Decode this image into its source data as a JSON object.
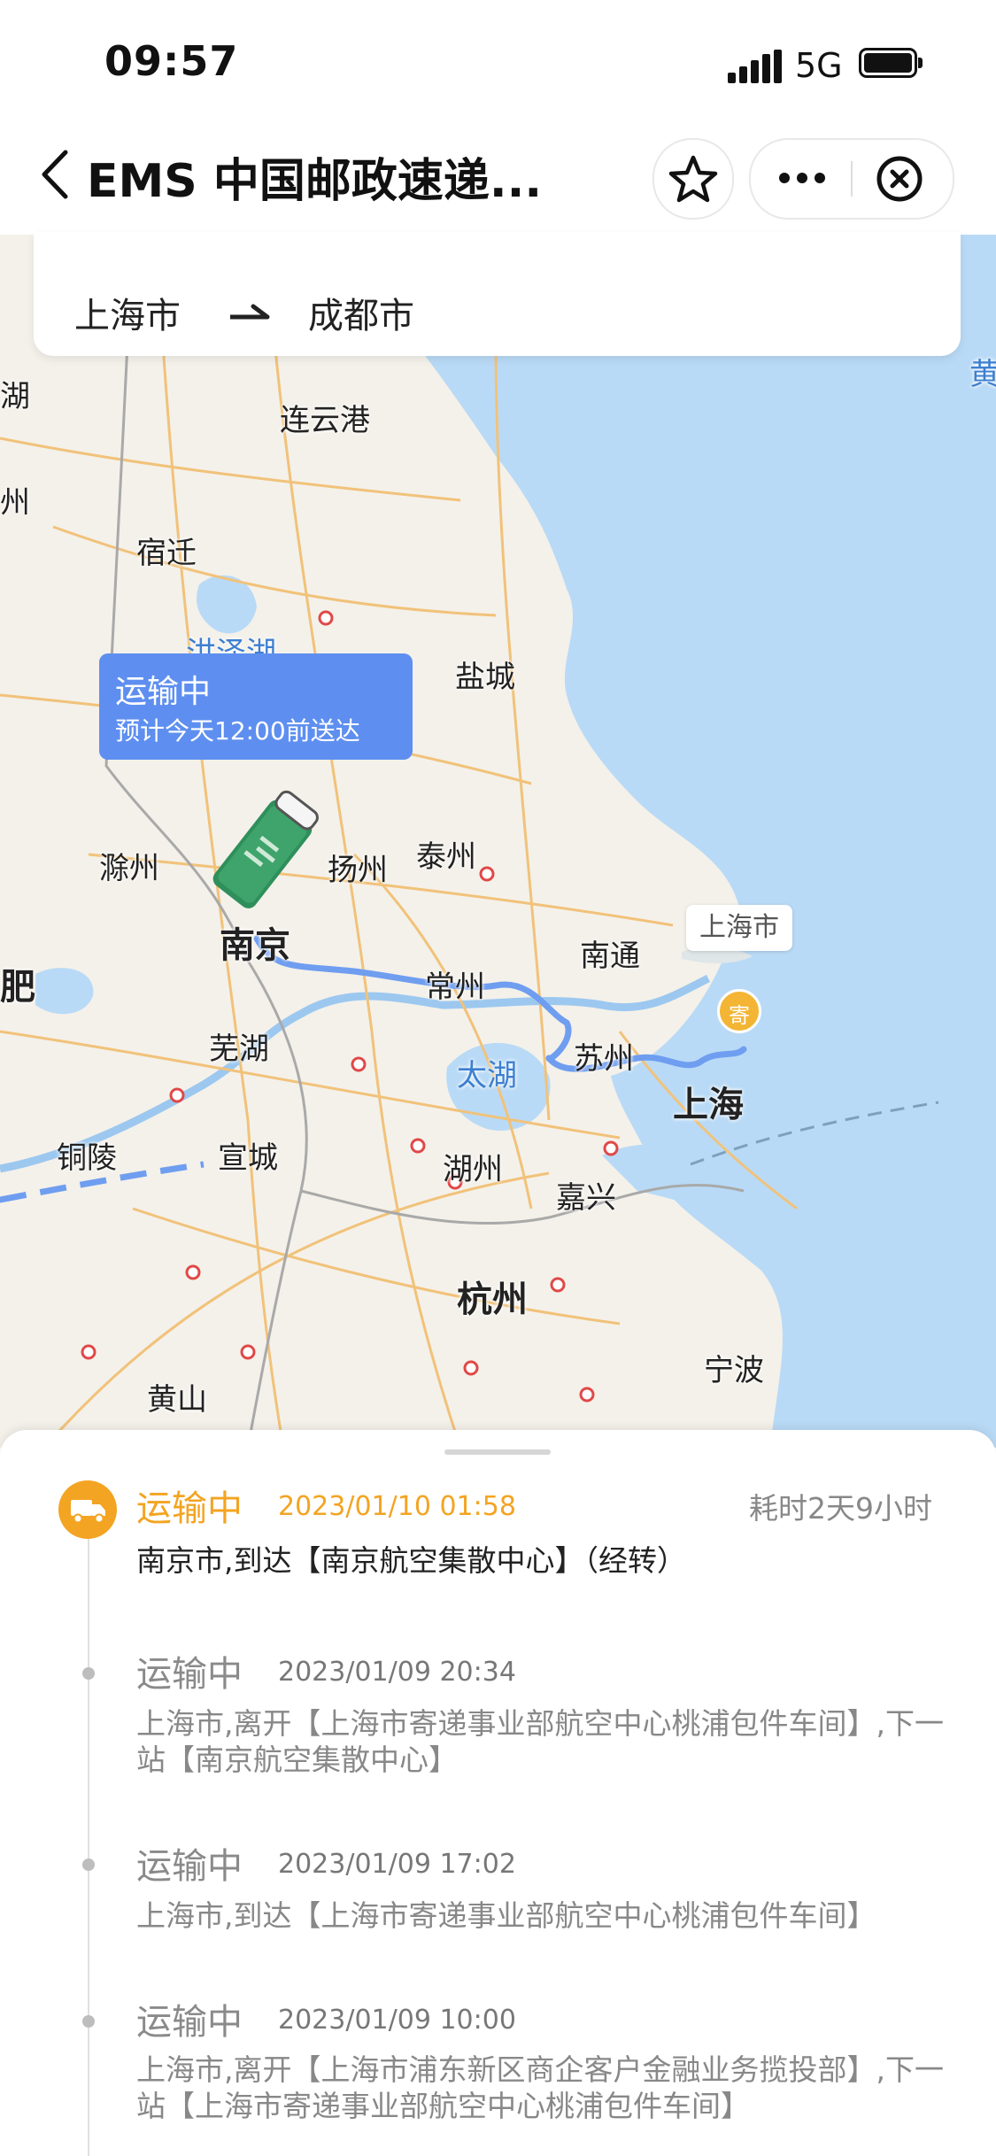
{
  "status_bar": {
    "time": "09:57",
    "network": "5G"
  },
  "nav": {
    "title": "EMS 中国邮政速递...",
    "icons": [
      "back-chevron-icon",
      "star-icon",
      "more-dots-icon",
      "close-circle-icon"
    ]
  },
  "route": {
    "from": "上海市",
    "to": "成都市",
    "arrow_icon": "harpoon-arrow-icon"
  },
  "map": {
    "cities": [
      "连云港",
      "宿迁",
      "盐城",
      "泰州",
      "扬州",
      "滁州",
      "南京",
      "南通",
      "常州",
      "苏州",
      "上海",
      "芜湖",
      "铜陵",
      "宣城",
      "湖州",
      "嘉兴",
      "杭州",
      "宁波",
      "黄山"
    ],
    "lakes": [
      "洪泽湖",
      "太湖"
    ],
    "edge_labels": [
      "湖",
      "州",
      "肥",
      "黄"
    ],
    "callout": {
      "title": "运输中",
      "subtitle": "预计今天12:00前送达"
    },
    "origin_label": "上海市",
    "origin_pin": "寄",
    "colors": {
      "land": "#f4f1ea",
      "sea": "#b9daf6",
      "route": "#6f9ef0",
      "callout": "#5e8ff0"
    }
  },
  "timeline": {
    "duration": "耗时2天9小时",
    "accent_color": "#f3a422",
    "events": [
      {
        "status": "运输中",
        "time": "2023/01/10 01:58",
        "desc": "南京市,到达【南京航空集散中心】（经转）"
      },
      {
        "status": "运输中",
        "time": "2023/01/09 20:34",
        "desc": "上海市,离开【上海市寄递事业部航空中心桃浦包件车间】,下一站【南京航空集散中心】"
      },
      {
        "status": "运输中",
        "time": "2023/01/09 17:02",
        "desc": "上海市,到达【上海市寄递事业部航空中心桃浦包件车间】"
      },
      {
        "status": "运输中",
        "time": "2023/01/09 10:00",
        "desc": "上海市,离开【上海市浦东新区商企客户金融业务揽投部】,下一站【上海市寄递事业部航空中心桃浦包件车间】"
      }
    ]
  }
}
